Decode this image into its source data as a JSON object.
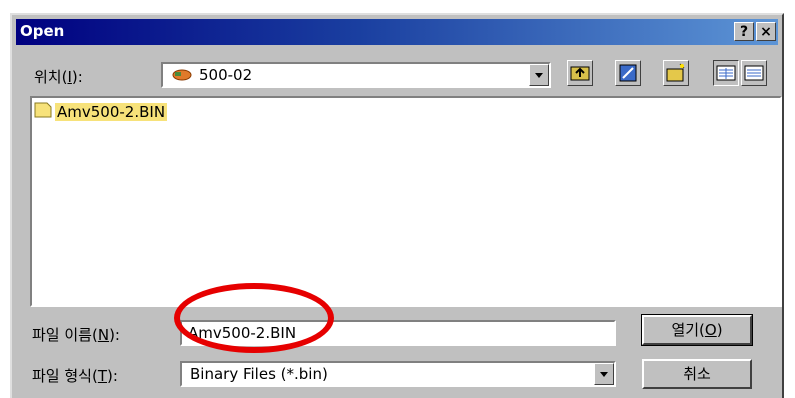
{
  "window": {
    "title": "Open",
    "help_label": "?",
    "close_label": "×"
  },
  "location": {
    "label_prefix": "위치(",
    "label_key": "I",
    "label_suffix": "):",
    "value": "500-02"
  },
  "toolbar": {
    "icons": [
      "up-folder-icon",
      "desktop-icon",
      "new-folder-icon",
      "list-view-icon",
      "details-view-icon"
    ]
  },
  "files": [
    {
      "name": "Amv500-2.BIN",
      "selected": true
    }
  ],
  "filename": {
    "label_prefix": "파일 이름(",
    "label_key": "N",
    "label_suffix": "):",
    "value": "Amv500-2.BIN"
  },
  "filetype": {
    "label_prefix": "파일 형식(",
    "label_key": "T",
    "label_suffix": "):",
    "value": "Binary Files (*.bin)"
  },
  "buttons": {
    "open_prefix": "열기(",
    "open_key": "O",
    "open_suffix": ")",
    "cancel": "취소"
  },
  "colors": {
    "highlight": "#e60000",
    "selection": "#f7e27a",
    "titlebar": "#000080"
  }
}
